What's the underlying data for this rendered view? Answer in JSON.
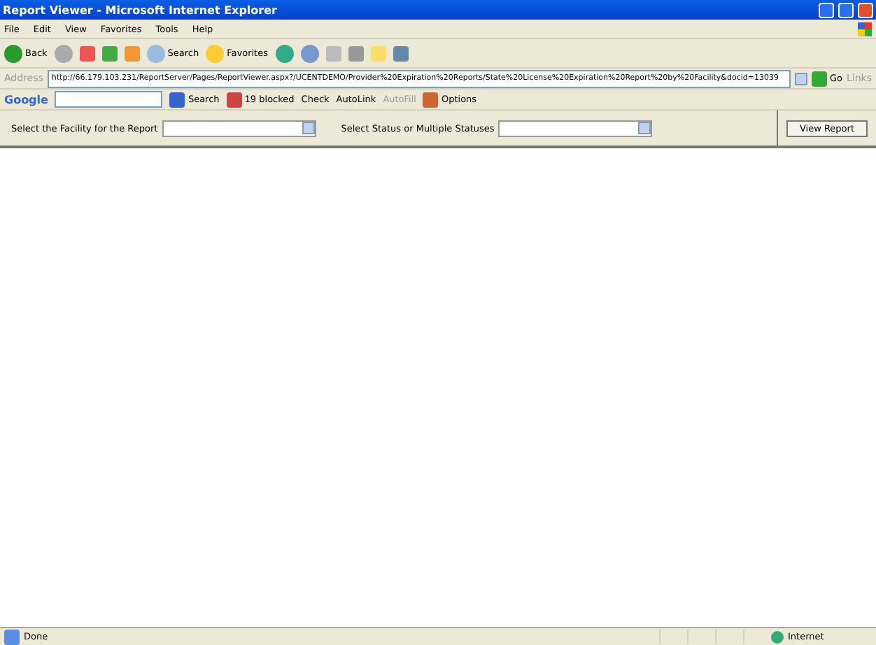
{
  "window": {
    "title": "Report Viewer - Microsoft Internet Explorer"
  },
  "menu": [
    "File",
    "Edit",
    "View",
    "Favorites",
    "Tools",
    "Help"
  ],
  "toolbar": {
    "back": "Back",
    "search": "Search",
    "favorites": "Favorites"
  },
  "address_bar": {
    "label": "Address",
    "url": "http://66.179.103.231/ReportServer/Pages/ReportViewer.aspx?/UCENTDEMO/Provider%20Expiration%20Reports/State%20License%20Expiration%20Report%20by%20Facility&docid=13039",
    "go": "Go",
    "links": "Links"
  },
  "google_bar": {
    "logo": "Google",
    "search": "Search",
    "blocked": "19 blocked",
    "check": "Check",
    "autolink": "AutoLink",
    "autofill": "AutoFill",
    "options": "Options"
  },
  "parameters": [
    {
      "label": "Select the Facility for the Report"
    },
    {
      "label": "Select Status or Multiple Statuses"
    }
  ],
  "view_report": "View Report",
  "status_bar": {
    "text": "Done",
    "zone": "Internet"
  }
}
